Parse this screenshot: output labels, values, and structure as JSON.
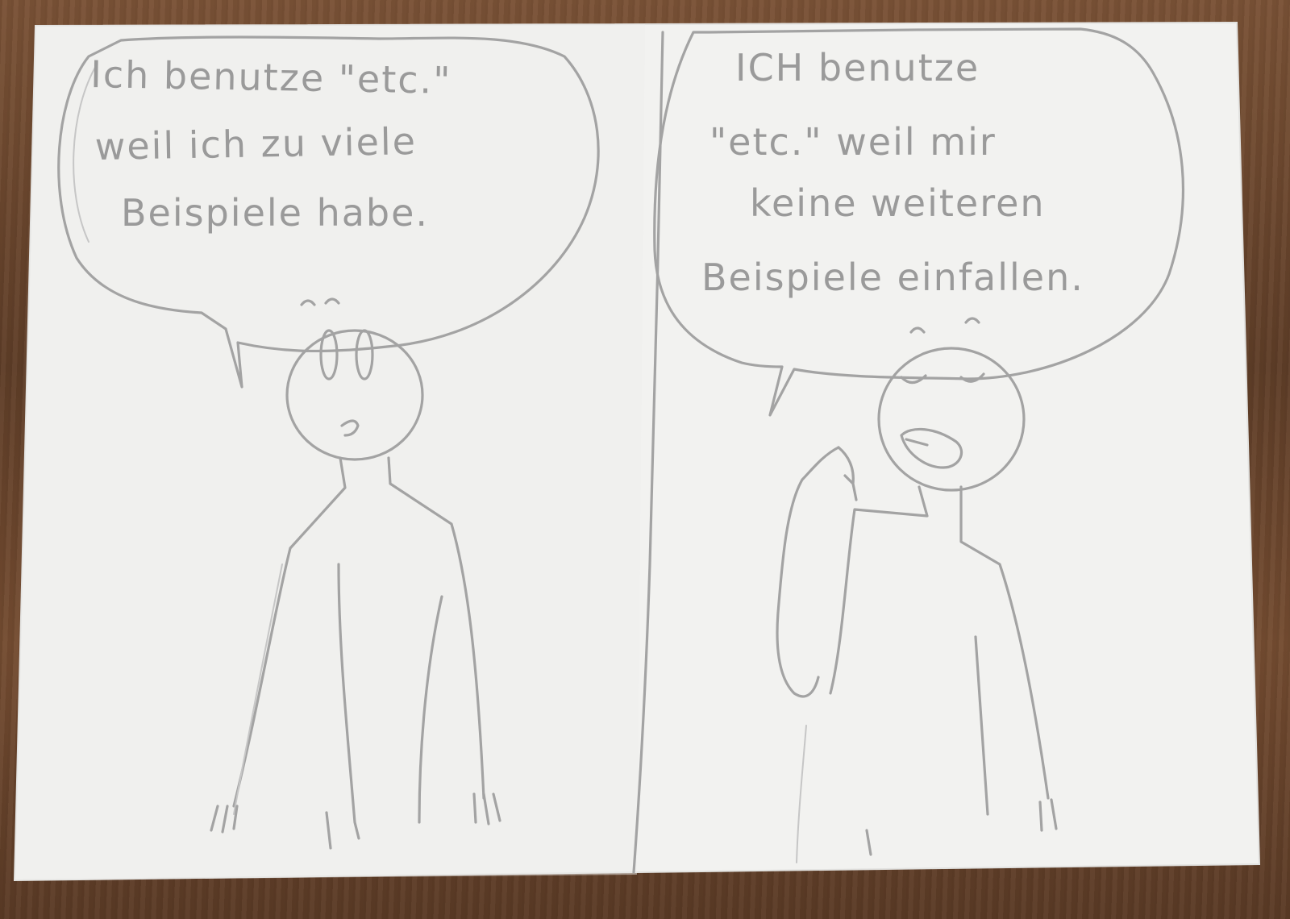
{
  "panels": [
    {
      "speech": [
        "Ich  benutze \"etc.\"",
        "weil   ich zu viele",
        "Beispiele habe."
      ]
    },
    {
      "speech": [
        "ICH  benutze",
        "\"etc.\"  weil  mir",
        "keine  weiteren",
        "Beispiele  einfallen."
      ]
    }
  ],
  "colors": {
    "paper": "#f3f3f1",
    "pencil": "#a3a3a3",
    "table": "#6e4a30"
  }
}
